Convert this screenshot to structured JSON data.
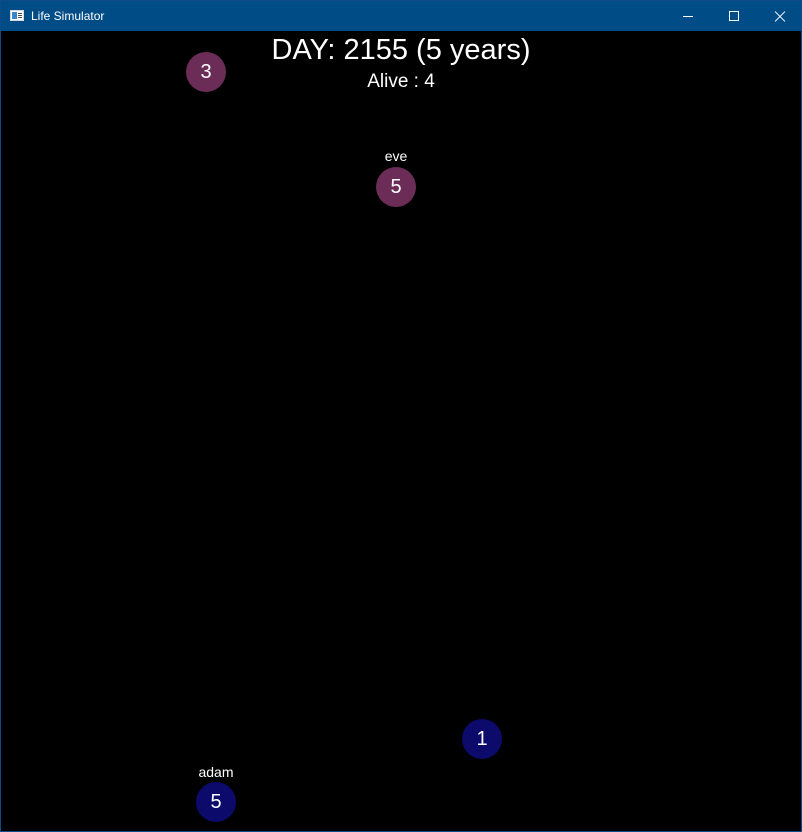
{
  "window": {
    "title": "Life Simulator",
    "icon": "app-window-icon",
    "controls": {
      "minimize_icon": "minimize-icon",
      "maximize_icon": "maximize-icon",
      "close_icon": "close-icon"
    }
  },
  "sim": {
    "day_text": "DAY: 2155 (5 years)",
    "alive_text": "Alive : 4"
  },
  "colors": {
    "titlebar": "#004c87",
    "background": "#000000",
    "female": "#6b2d57",
    "male": "#0c0a6b",
    "text": "#ffffff"
  },
  "entities": [
    {
      "value": "3",
      "name": "",
      "color": "#6b2d57"
    },
    {
      "value": "5",
      "name": "eve",
      "color": "#6b2d57"
    },
    {
      "value": "1",
      "name": "",
      "color": "#0c0a6b"
    },
    {
      "value": "5",
      "name": "adam",
      "color": "#0c0a6b"
    }
  ]
}
